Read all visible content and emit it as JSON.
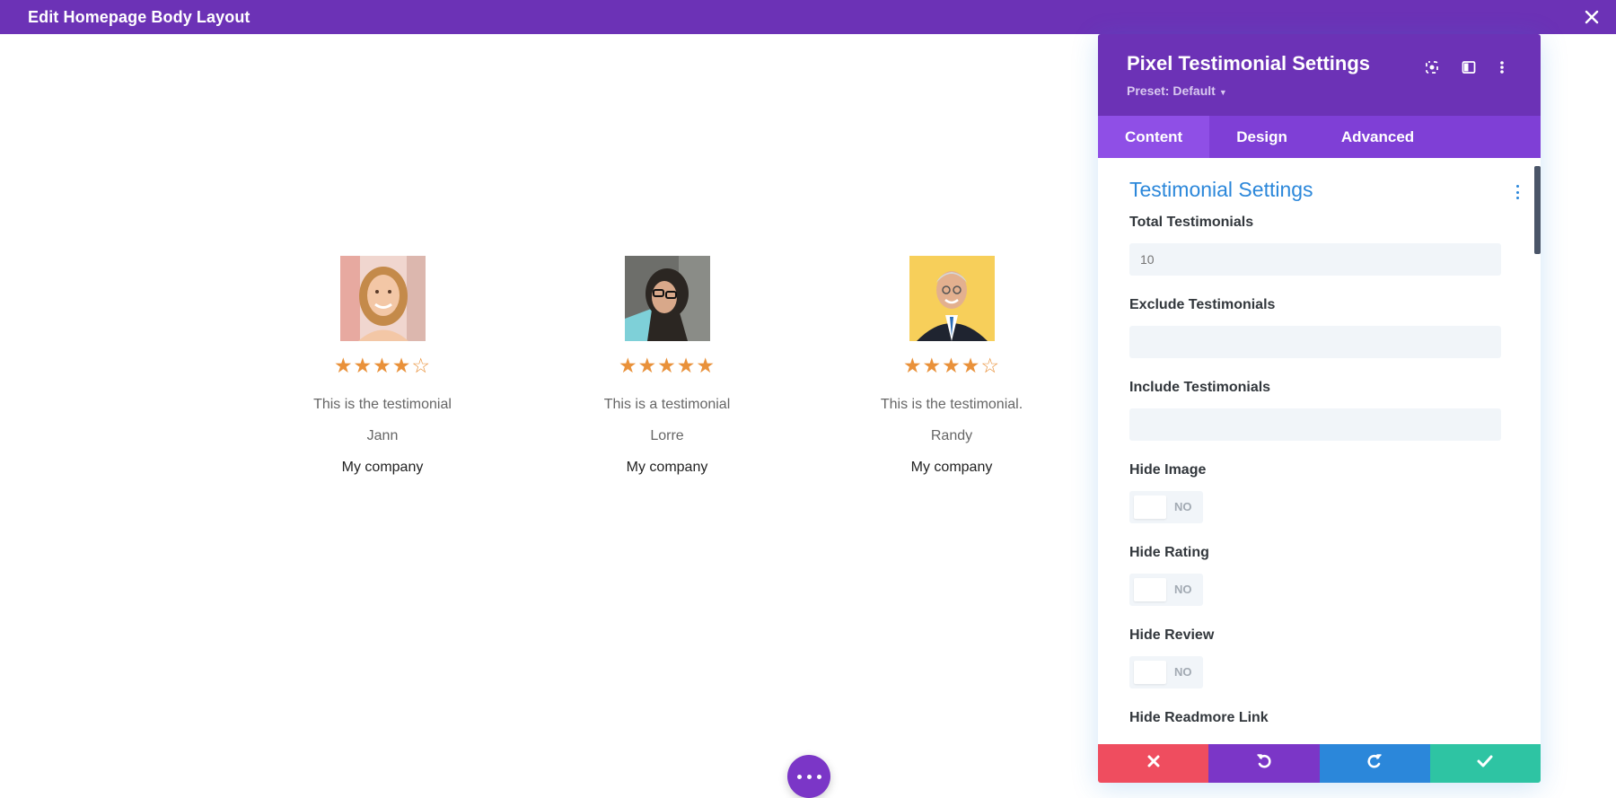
{
  "topbar": {
    "title": "Edit Homepage Body Layout",
    "close_icon": "close-icon"
  },
  "testimonials": [
    {
      "review": "This is the testimonial",
      "name": "Jann",
      "company": "My company",
      "rating": 4,
      "stars": "★★★★☆"
    },
    {
      "review": "This is a testimonial",
      "name": "Lorre",
      "company": "My company",
      "rating": 5,
      "stars": "★★★★★"
    },
    {
      "review": "This is the testimonial.",
      "name": "Randy",
      "company": "My company",
      "rating": 4,
      "stars": "★★★★☆"
    }
  ],
  "panel": {
    "title": "Pixel Testimonial Settings",
    "preset": "Preset: Default",
    "tabs": [
      {
        "label": "Content"
      },
      {
        "label": "Design"
      },
      {
        "label": "Advanced"
      }
    ],
    "active_tab": "Content",
    "section_title": "Testimonial Settings",
    "fields": {
      "total": {
        "label": "Total Testimonials",
        "placeholder": "10"
      },
      "exclude": {
        "label": "Exclude Testimonials",
        "value": ""
      },
      "include": {
        "label": "Include Testimonials",
        "value": ""
      },
      "hide_image": {
        "label": "Hide Image",
        "state": "NO"
      },
      "hide_rating": {
        "label": "Hide Rating",
        "state": "NO"
      },
      "hide_review": {
        "label": "Hide Review",
        "state": "NO"
      },
      "hide_readmore": {
        "label": "Hide Readmore Link"
      }
    }
  },
  "colors": {
    "purple": "#6c32b6",
    "tab_purple": "#7f3fd6",
    "accent_blue": "#2b87da",
    "star_orange": "#e9913a",
    "cancel": "#ef4d5f",
    "undo": "#7b36c7",
    "redo": "#2b87da",
    "save": "#2ec4a3"
  },
  "icons": [
    "close-icon",
    "target-icon",
    "split-view-icon",
    "more-vertical-icon",
    "cancel-icon",
    "undo-icon",
    "redo-icon",
    "check-icon",
    "more-horizontal-icon"
  ]
}
